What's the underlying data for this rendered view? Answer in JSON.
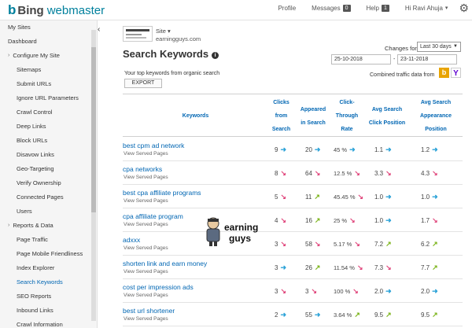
{
  "header": {
    "logo_mark": "b",
    "brand": "Bing",
    "product": "webmaster",
    "profile": "Profile",
    "messages": "Messages",
    "messages_count": "0",
    "help": "Help",
    "help_count": "1",
    "user": "Hi Ravi Ahuja",
    "caret": "▾",
    "settings_icon": "gear-icon"
  },
  "sidebar": {
    "collapse_glyph": "‹",
    "items": [
      {
        "label": "My Sites",
        "level": "top"
      },
      {
        "label": "Dashboard",
        "level": "top"
      },
      {
        "label": "Configure My Site",
        "level": "group"
      },
      {
        "label": "Sitemaps",
        "level": "sub"
      },
      {
        "label": "Submit URLs",
        "level": "sub"
      },
      {
        "label": "Ignore URL Parameters",
        "level": "sub"
      },
      {
        "label": "Crawl Control",
        "level": "sub"
      },
      {
        "label": "Deep Links",
        "level": "sub"
      },
      {
        "label": "Block URLs",
        "level": "sub"
      },
      {
        "label": "Disavow Links",
        "level": "sub"
      },
      {
        "label": "Geo-Targeting",
        "level": "sub"
      },
      {
        "label": "Verify Ownership",
        "level": "sub"
      },
      {
        "label": "Connected Pages",
        "level": "sub"
      },
      {
        "label": "Users",
        "level": "sub"
      },
      {
        "label": "Reports & Data",
        "level": "group"
      },
      {
        "label": "Page Traffic",
        "level": "sub"
      },
      {
        "label": "Page Mobile Friendliness",
        "level": "sub"
      },
      {
        "label": "Index Explorer",
        "level": "sub"
      },
      {
        "label": "Search Keywords",
        "level": "sub",
        "active": true
      },
      {
        "label": "SEO Reports",
        "level": "sub"
      },
      {
        "label": "Inbound Links",
        "level": "sub"
      },
      {
        "label": "Crawl Information",
        "level": "sub"
      }
    ]
  },
  "site": {
    "label": "Site ▾",
    "url": "earningguys.com"
  },
  "page": {
    "title": "Search Keywords",
    "info_glyph": "i",
    "changes_for": "Changes for",
    "range": "Last 30 days",
    "date_from": "25-10-2018",
    "date_sep": "-",
    "date_to": "23-11-2018",
    "description": "Your top keywords from organic search",
    "export": "EXPORT",
    "combined": "Combined traffic data from",
    "bing_glyph": "b",
    "yahoo_glyph": "Y"
  },
  "table": {
    "headers": {
      "keywords": "Keywords",
      "clicks": "Clicks from Search",
      "appeared": "Appeared in Search",
      "ctr": "Click-Through Rate",
      "avg_click": "Avg Search Click Position",
      "avg_appear": "Avg Search Appearance Position"
    },
    "served_label": "View Served Pages",
    "colors": {
      "flat": "#2ea3d8",
      "down": "#e0457b",
      "up": "#7ab317"
    },
    "rows": [
      {
        "keyword": "best cpm ad network",
        "clicks": "9",
        "clicks_t": "flat",
        "appeared": "20",
        "appeared_t": "flat",
        "ctr": "45 %",
        "ctr_t": "flat",
        "avg_click": "1.1",
        "avg_click_t": "flat",
        "avg_appear": "1.2",
        "avg_appear_t": "flat"
      },
      {
        "keyword": "cpa networks",
        "clicks": "8",
        "clicks_t": "down",
        "appeared": "64",
        "appeared_t": "down",
        "ctr": "12.5 %",
        "ctr_t": "down",
        "avg_click": "3.3",
        "avg_click_t": "down",
        "avg_appear": "4.3",
        "avg_appear_t": "down"
      },
      {
        "keyword": "best cpa affiliate programs",
        "clicks": "5",
        "clicks_t": "down",
        "appeared": "11",
        "appeared_t": "up",
        "ctr": "45.45 %",
        "ctr_t": "down",
        "avg_click": "1.0",
        "avg_click_t": "flat",
        "avg_appear": "1.0",
        "avg_appear_t": "flat"
      },
      {
        "keyword": "cpa affiliate program",
        "clicks": "4",
        "clicks_t": "down",
        "appeared": "16",
        "appeared_t": "up",
        "ctr": "25 %",
        "ctr_t": "down",
        "avg_click": "1.0",
        "avg_click_t": "flat",
        "avg_appear": "1.7",
        "avg_appear_t": "down"
      },
      {
        "keyword": "adxxx",
        "clicks": "3",
        "clicks_t": "down",
        "appeared": "58",
        "appeared_t": "down",
        "ctr": "5.17 %",
        "ctr_t": "down",
        "avg_click": "7.2",
        "avg_click_t": "up",
        "avg_appear": "6.2",
        "avg_appear_t": "up"
      },
      {
        "keyword": "shorten link and earn money",
        "clicks": "3",
        "clicks_t": "flat",
        "appeared": "26",
        "appeared_t": "up",
        "ctr": "11.54 %",
        "ctr_t": "down",
        "avg_click": "7.3",
        "avg_click_t": "down",
        "avg_appear": "7.7",
        "avg_appear_t": "up"
      },
      {
        "keyword": "cost per impression ads",
        "clicks": "3",
        "clicks_t": "down",
        "appeared": "3",
        "appeared_t": "down",
        "ctr": "100 %",
        "ctr_t": "down",
        "avg_click": "2.0",
        "avg_click_t": "flat",
        "avg_appear": "2.0",
        "avg_appear_t": "flat"
      },
      {
        "keyword": "best url shortener",
        "clicks": "2",
        "clicks_t": "flat",
        "appeared": "55",
        "appeared_t": "flat",
        "ctr": "3.64 %",
        "ctr_t": "up",
        "avg_click": "9.5",
        "avg_click_t": "up",
        "avg_appear": "9.5",
        "avg_appear_t": "up"
      }
    ]
  },
  "watermark": {
    "line1": "earning",
    "line2": "guys"
  }
}
